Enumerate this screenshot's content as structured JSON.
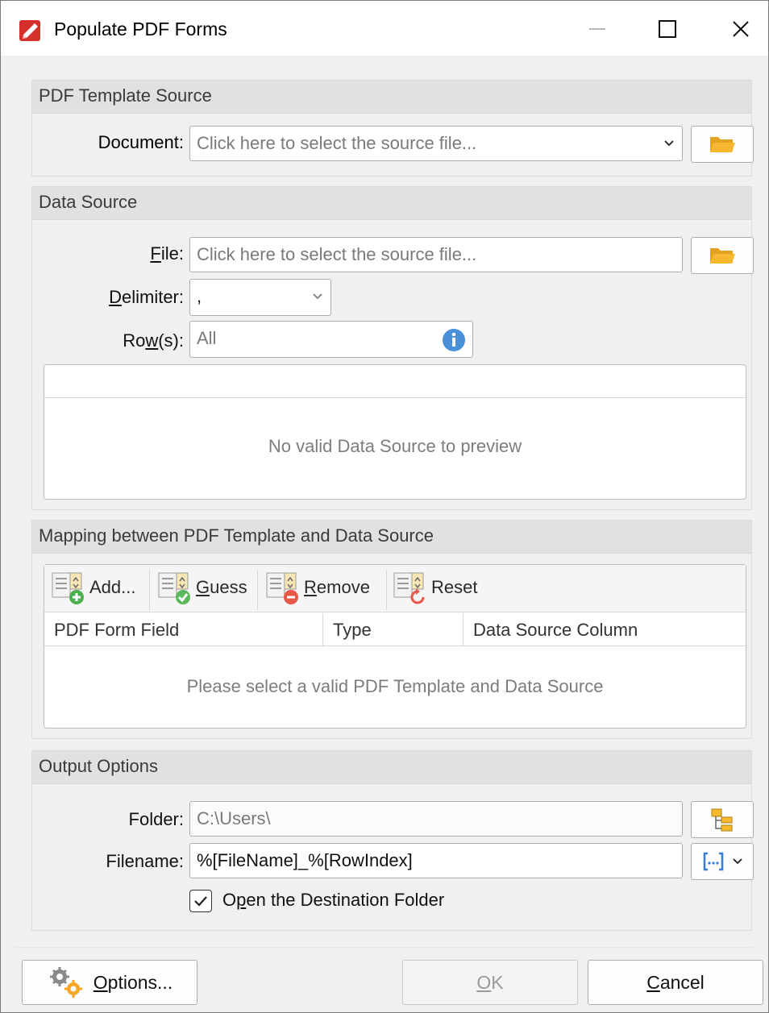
{
  "window": {
    "title": "Populate PDF Forms",
    "icon": "app-pdf-icon",
    "controls": {
      "minimize": "minimize-icon",
      "maximize": "maximize-icon",
      "close": "close-icon"
    }
  },
  "template_source": {
    "heading": "PDF Template Source",
    "document_label": "Document:",
    "document_placeholder": "Click here to select the source file...",
    "browse_icon": "folder-icon"
  },
  "data_source": {
    "heading": "Data Source",
    "file_label": "File:",
    "file_placeholder": "Click here to select the source file...",
    "delimiter_label": "Delimiter:",
    "delimiter_value": ",",
    "rows_label": "Row(s):",
    "rows_value": "All",
    "info_icon": "info-icon",
    "preview_empty": "No valid Data Source to preview"
  },
  "mapping": {
    "heading": "Mapping between PDF Template and Data Source",
    "toolbar": [
      {
        "label": "Add...",
        "icon": "add-field-icon"
      },
      {
        "label": "Guess",
        "icon": "guess-field-icon"
      },
      {
        "label": "Remove",
        "icon": "remove-field-icon"
      },
      {
        "label": "Reset",
        "icon": "reset-field-icon"
      }
    ],
    "columns": [
      "PDF Form Field",
      "Type",
      "Data Source Column"
    ],
    "empty": "Please select a valid PDF Template and Data Source"
  },
  "output": {
    "heading": "Output Options",
    "folder_label": "Folder:",
    "folder_value": "C:\\Users\\",
    "filename_label": "Filename:",
    "filename_value": "%[FileName]_%[RowIndex]",
    "open_folder_label": "Open the Destination Folder",
    "open_folder_checked": true
  },
  "footer": {
    "options_label": "Options...",
    "ok_label": "OK",
    "cancel_label": "Cancel"
  },
  "colors": {
    "folder": "#f5b82e",
    "info": "#4a90d9",
    "add": "#4caf50",
    "remove": "#e8584a",
    "reset": "#e8584a"
  }
}
